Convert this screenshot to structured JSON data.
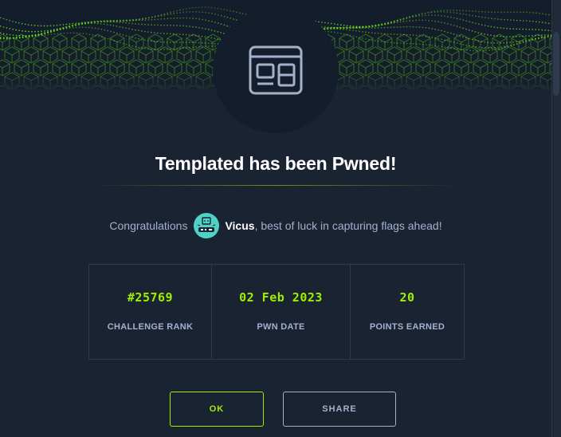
{
  "modal": {
    "title": "Templated has been Pwned!",
    "congrats_prefix": "Congratulations",
    "username": "Vicus",
    "congrats_suffix": ", best of luck in capturing flags ahead!",
    "challenge_icon": "template-layout-icon",
    "avatar_icon": "robot-avatar-icon"
  },
  "stats": [
    {
      "value": "#25769",
      "label": "CHALLENGE RANK"
    },
    {
      "value": "02 Feb 2023",
      "label": "PWN DATE"
    },
    {
      "value": "20",
      "label": "POINTS EARNED"
    }
  ],
  "buttons": {
    "ok": "OK",
    "share": "SHARE"
  },
  "colors": {
    "background": "#1a2332",
    "accent": "#9fef00",
    "text_muted": "#a4b1cd",
    "avatar": "#4fd1c5"
  }
}
